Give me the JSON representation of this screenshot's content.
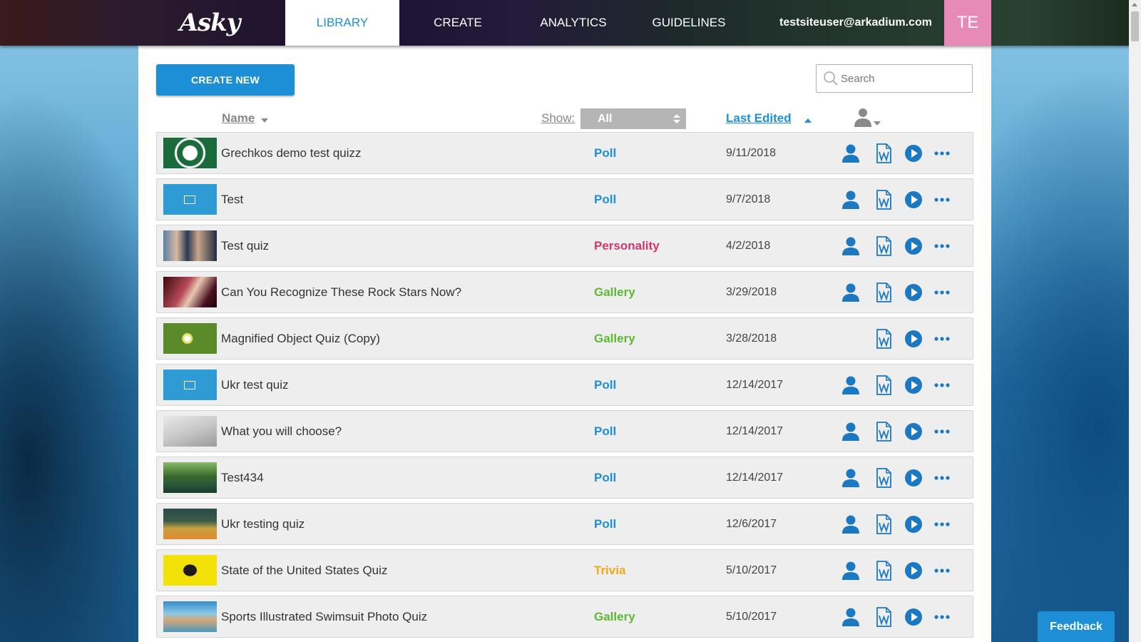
{
  "header": {
    "logo": "Asky",
    "tabs": [
      {
        "label": "LIBRARY"
      },
      {
        "label": "CREATE"
      },
      {
        "label": "ANALYTICS"
      },
      {
        "label": "GUIDELINES"
      }
    ],
    "user_email": "testsiteuser@arkadium.com",
    "avatar_initials": "TE"
  },
  "toolbar": {
    "create_label": "CREATE NEW",
    "search_placeholder": "Search"
  },
  "columns": {
    "name": "Name",
    "show": "Show:",
    "show_value": "All",
    "last_edited": "Last Edited"
  },
  "colors": {
    "accent": "#1c8fd6",
    "poll": "#1c8fd6",
    "personality": "#d3366a",
    "gallery": "#5fb832",
    "trivia": "#f0a91e"
  },
  "rows": [
    {
      "name": "Grechkos demo test quizz",
      "type": "Poll",
      "date": "9/11/2018",
      "owner": true,
      "thumb": "seal-logo"
    },
    {
      "name": "Test",
      "type": "Poll",
      "date": "9/7/2018",
      "owner": true,
      "thumb": "placeholder"
    },
    {
      "name": "Test quiz",
      "type": "Personality",
      "date": "4/2/2018",
      "owner": true,
      "thumb": "photo-people"
    },
    {
      "name": "Can You Recognize These Rock Stars Now?",
      "type": "Gallery",
      "date": "3/29/2018",
      "owner": true,
      "thumb": "photo-guitarist"
    },
    {
      "name": "Magnified Object Quiz (Copy)",
      "type": "Gallery",
      "date": "3/28/2018",
      "owner": false,
      "thumb": "photo-flowers"
    },
    {
      "name": "Ukr test quiz",
      "type": "Poll",
      "date": "12/14/2017",
      "owner": true,
      "thumb": "placeholder"
    },
    {
      "name": "What you will choose?",
      "type": "Poll",
      "date": "12/14/2017",
      "owner": true,
      "thumb": "photo-ballot"
    },
    {
      "name": "Test434",
      "type": "Poll",
      "date": "12/14/2017",
      "owner": true,
      "thumb": "photo-landscape"
    },
    {
      "name": "Ukr testing quiz",
      "type": "Poll",
      "date": "12/6/2017",
      "owner": true,
      "thumb": "photo-poster"
    },
    {
      "name": "State of the United States Quiz",
      "type": "Trivia",
      "date": "5/10/2017",
      "owner": true,
      "thumb": "flag-snake"
    },
    {
      "name": "Sports Illustrated Swimsuit Photo Quiz",
      "type": "Gallery",
      "date": "5/10/2017",
      "owner": true,
      "thumb": "photo-beach"
    }
  ],
  "feedback_label": "Feedback"
}
